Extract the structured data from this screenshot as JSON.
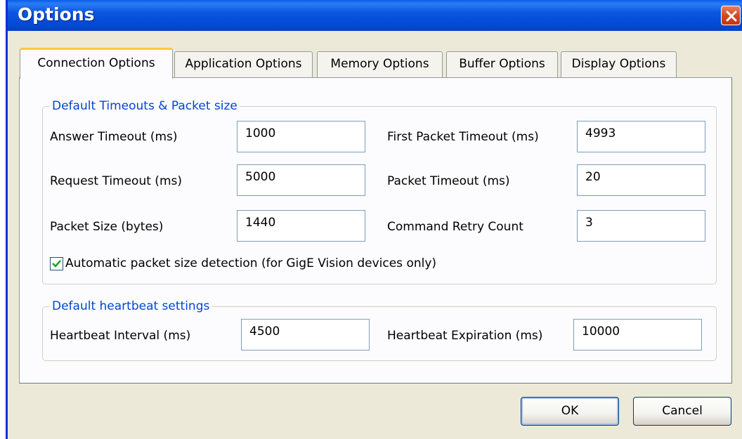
{
  "window": {
    "title": "Options"
  },
  "tabs": [
    {
      "label": "Connection Options",
      "active": true
    },
    {
      "label": "Application Options",
      "active": false
    },
    {
      "label": "Memory Options",
      "active": false
    },
    {
      "label": "Buffer Options",
      "active": false
    },
    {
      "label": "Display Options",
      "active": false
    }
  ],
  "timeouts_group": {
    "title": "Default Timeouts & Packet size",
    "answer_timeout": {
      "label": "Answer Timeout (ms)",
      "value": "1000"
    },
    "request_timeout": {
      "label": "Request Timeout (ms)",
      "value": "5000"
    },
    "packet_size": {
      "label": "Packet Size (bytes)",
      "value": "1440"
    },
    "first_packet_timeout": {
      "label": "First Packet Timeout (ms)",
      "value": "4993"
    },
    "packet_timeout": {
      "label": "Packet Timeout (ms)",
      "value": "20"
    },
    "command_retry_count": {
      "label": "Command Retry Count",
      "value": "3"
    },
    "auto_packet_size": {
      "label": "Automatic packet size detection (for GigE Vision devices only)",
      "checked": true
    }
  },
  "heartbeat_group": {
    "title": "Default heartbeat settings",
    "heartbeat_interval": {
      "label": "Heartbeat Interval (ms)",
      "value": "4500"
    },
    "heartbeat_expiration": {
      "label": "Heartbeat Expiration (ms)",
      "value": "10000"
    }
  },
  "buttons": {
    "ok": "OK",
    "cancel": "Cancel"
  },
  "colors": {
    "title_bar": "#0b57e0",
    "group_title": "#0046d5",
    "active_tab_accent": "#ffc83c",
    "dialog_bg": "#ece9d8"
  }
}
